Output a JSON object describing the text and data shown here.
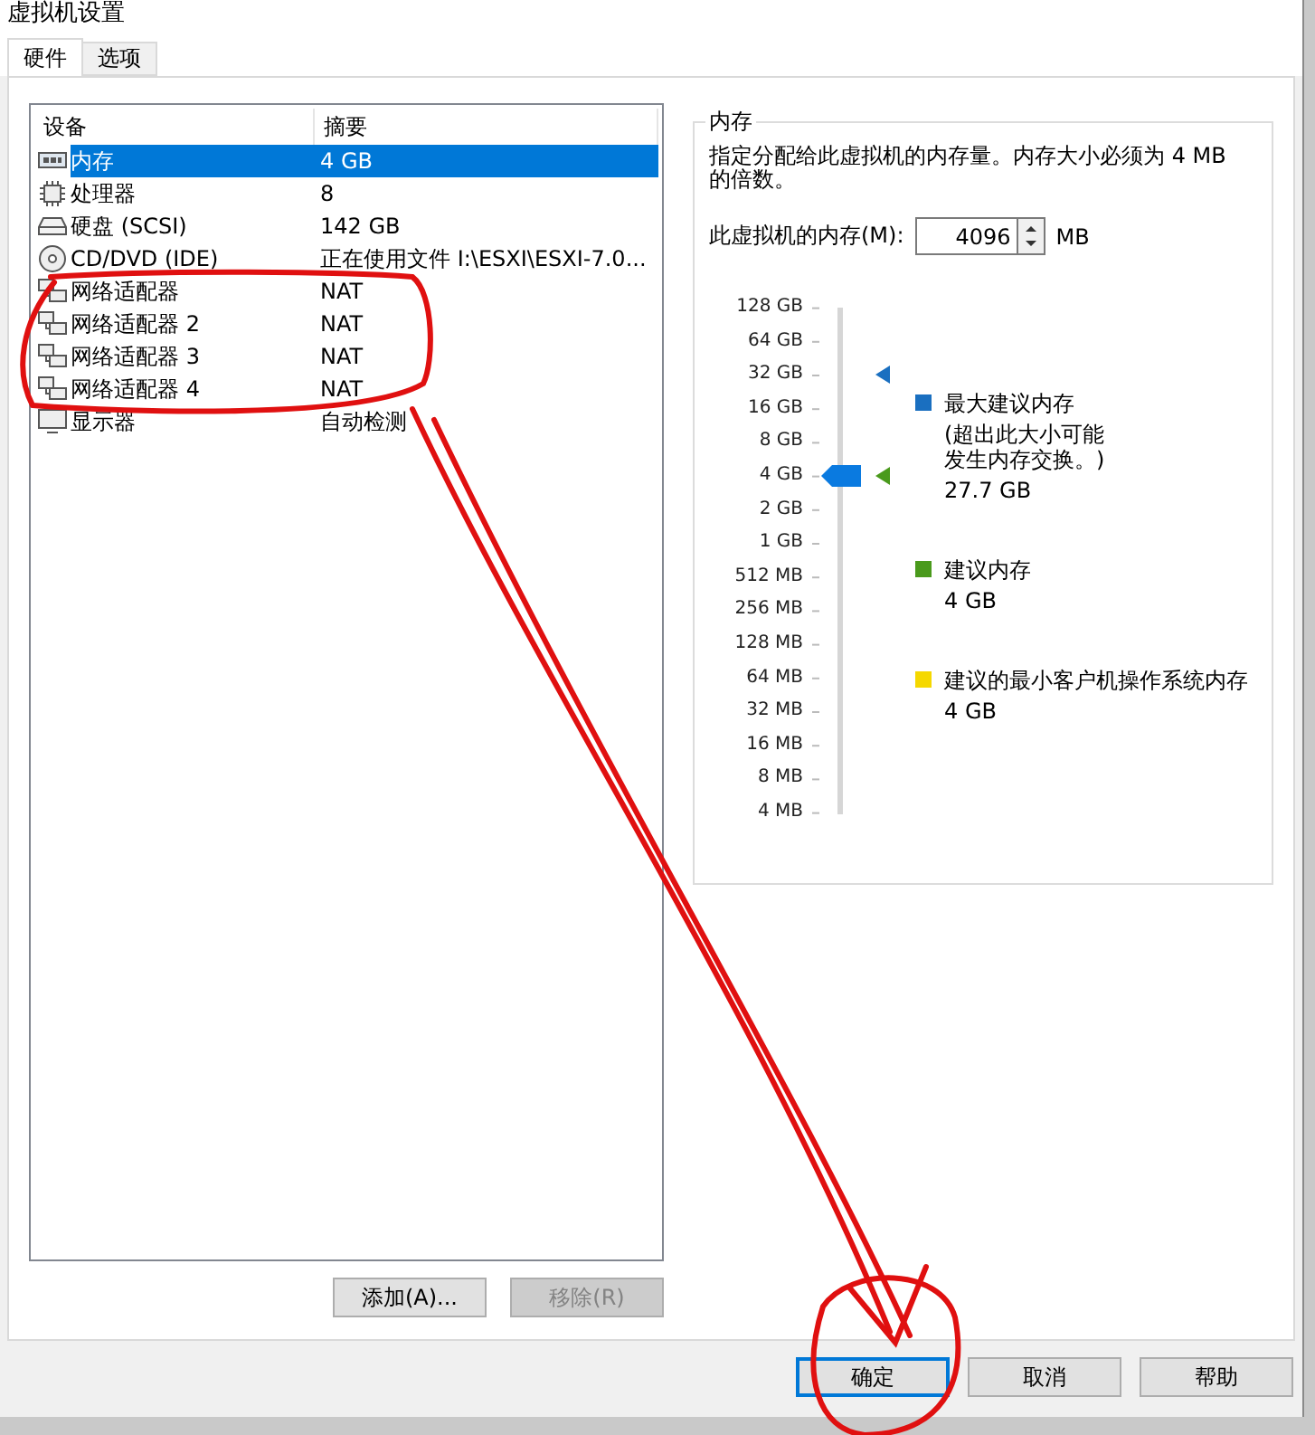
{
  "window": {
    "title": "虚拟机设置"
  },
  "tabs": [
    {
      "label": "硬件",
      "selected": true
    },
    {
      "label": "选项",
      "selected": false
    }
  ],
  "device_table": {
    "columns": [
      "设备",
      "摘要"
    ],
    "rows": [
      {
        "kind": "memory",
        "device": "内存",
        "summary": "4 GB",
        "selected": true
      },
      {
        "kind": "cpu",
        "device": "处理器",
        "summary": "8",
        "selected": false
      },
      {
        "kind": "disk",
        "device": "硬盘 (SCSI)",
        "summary": "142 GB",
        "selected": false
      },
      {
        "kind": "cd",
        "device": "CD/DVD (IDE)",
        "summary": "正在使用文件 I:\\ESXI\\ESXI-7.0...",
        "selected": false
      },
      {
        "kind": "network",
        "device": "网络适配器",
        "summary": "NAT",
        "selected": false
      },
      {
        "kind": "network",
        "device": "网络适配器 2",
        "summary": "NAT",
        "selected": false
      },
      {
        "kind": "network",
        "device": "网络适配器 3",
        "summary": "NAT",
        "selected": false
      },
      {
        "kind": "network",
        "device": "网络适配器 4",
        "summary": "NAT",
        "selected": false
      },
      {
        "kind": "display",
        "device": "显示器",
        "summary": "自动检测",
        "selected": false
      }
    ]
  },
  "list_buttons": [
    {
      "label": "添加(A)...",
      "disabled": false
    },
    {
      "label": "移除(R)",
      "disabled": true
    }
  ],
  "memory": {
    "title": "内存",
    "description": "指定分配给此虚拟机的内存量。内存大小必须为 4 MB 的倍数。",
    "field_label": "此虚拟机的内存(M):",
    "value": "4096",
    "unit": "MB",
    "scale": [
      "128 GB",
      "64 GB",
      "32 GB",
      "16 GB",
      "8 GB",
      "4 GB",
      "2 GB",
      "1 GB",
      "512 MB",
      "256 MB",
      "128 MB",
      "64 MB",
      "32 MB",
      "16 MB",
      "8 MB",
      "4 MB"
    ],
    "slider": {
      "level": 0.667
    },
    "markers": [
      {
        "color": "#1a6fc0",
        "level": 0.867
      },
      {
        "color": "#4a9a1c",
        "level": 0.667
      }
    ],
    "legend": [
      {
        "color": "#1a6fc0",
        "label": "最大建议内存",
        "note": "(超出此大小可能发生内存交换。)",
        "value": "27.7 GB"
      },
      {
        "color": "#4a9a1c",
        "label": "建议内存",
        "value": "4 GB"
      },
      {
        "color": "#f5d800",
        "label": "建议的最小客户机操作系统内存",
        "value": "4 GB"
      }
    ]
  },
  "footer_buttons": [
    {
      "label": "确定",
      "default": true
    },
    {
      "label": "取消",
      "default": false
    },
    {
      "label": "帮助",
      "default": false
    }
  ]
}
